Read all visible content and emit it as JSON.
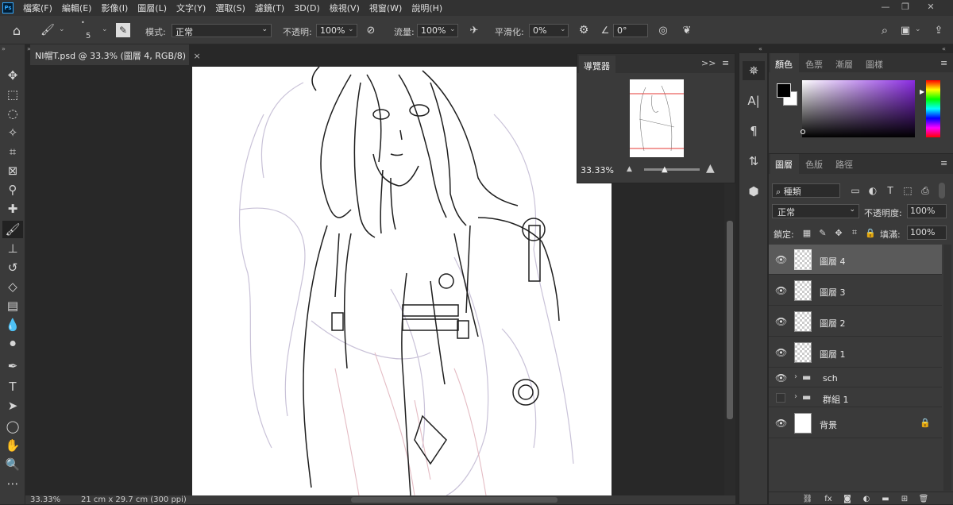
{
  "menubar": {
    "logo": "Ps",
    "items": [
      "檔案(F)",
      "編輯(E)",
      "影像(I)",
      "圖層(L)",
      "文字(Y)",
      "選取(S)",
      "濾鏡(T)",
      "3D(D)",
      "檢視(V)",
      "視窗(W)",
      "說明(H)"
    ]
  },
  "window_controls": {
    "minimize": "—",
    "restore": "❐",
    "close": "✕"
  },
  "options": {
    "brush_size": "5",
    "mode_label": "模式:",
    "mode_value": "正常",
    "opacity_label": "不透明:",
    "opacity_value": "100%",
    "flow_label": "流量:",
    "flow_value": "100%",
    "smoothing_label": "平滑化:",
    "smoothing_value": "0%",
    "angle_value": "0°"
  },
  "document": {
    "tab_title": "NI帽T.psd @ 33.3% (圖層 4, RGB/8)",
    "close": "×"
  },
  "statusbar": {
    "zoom": "33.33%",
    "doc_size": "21 cm x 29.7 cm (300 ppi)"
  },
  "navigator": {
    "title": "導覽器",
    "zoom": "33.33%"
  },
  "color_panel": {
    "tabs": [
      "顏色",
      "色票",
      "漸層",
      "圖樣"
    ],
    "colors": {
      "foreground": "#000000",
      "background": "#ffffff",
      "hue": "#8a2be2"
    }
  },
  "layers_panel": {
    "tabs": [
      "圖層",
      "色版",
      "路徑"
    ],
    "filter_label": "種類",
    "blend_mode": "正常",
    "opacity_label": "不透明度:",
    "opacity_value": "100%",
    "lock_label": "鎖定:",
    "fill_label": "填滿:",
    "fill_value": "100%",
    "layers": [
      {
        "name": "圖層 4",
        "type": "layer",
        "visible": true,
        "selected": true
      },
      {
        "name": "圖層 3",
        "type": "layer",
        "visible": true,
        "selected": false
      },
      {
        "name": "圖層 2",
        "type": "layer",
        "visible": true,
        "selected": false
      },
      {
        "name": "圖層 1",
        "type": "layer",
        "visible": true,
        "selected": false
      },
      {
        "name": "sch",
        "type": "group",
        "visible": true,
        "selected": false
      },
      {
        "name": "群組 1",
        "type": "group",
        "visible": false,
        "selected": false
      },
      {
        "name": "背景",
        "type": "background",
        "visible": true,
        "selected": false,
        "locked": true
      }
    ]
  }
}
